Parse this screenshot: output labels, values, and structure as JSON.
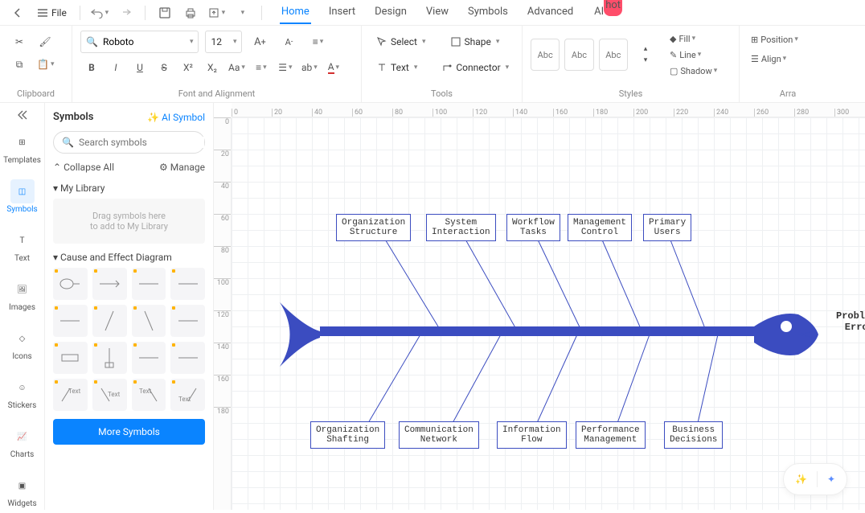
{
  "menubar": {
    "file": "File"
  },
  "tabs": [
    "Home",
    "Insert",
    "Design",
    "View",
    "Symbols",
    "Advanced",
    "AI"
  ],
  "hot": "hot",
  "ribbon": {
    "font_name": "Roboto",
    "font_size": "12",
    "select": "Select",
    "shape": "Shape",
    "text": "Text",
    "connector": "Connector",
    "abc": "Abc",
    "fill": "Fill",
    "line": "Line",
    "shadow": "Shadow",
    "position": "Position",
    "align": "Align",
    "groups": {
      "clipboard": "Clipboard",
      "font": "Font and Alignment",
      "tools": "Tools",
      "styles": "Styles",
      "arrange": "Arra"
    }
  },
  "rail": {
    "templates": "Templates",
    "symbols": "Symbols",
    "text": "Text",
    "images": "Images",
    "icons": "Icons",
    "stickers": "Stickers",
    "charts": "Charts",
    "widgets": "Widgets"
  },
  "sidebar": {
    "title": "Symbols",
    "ai": "AI Symbol",
    "search_ph": "Search symbols",
    "collapse": "Collapse All",
    "manage": "Manage",
    "mylib": "My Library",
    "drop1": "Drag symbols here",
    "drop2": "to add to My Library",
    "cat": "Cause and Effect Diagram",
    "more": "More Symbols"
  },
  "ruler_h": [
    "0",
    "20",
    "40",
    "60",
    "80",
    "100",
    "120",
    "140",
    "160",
    "180",
    "200",
    "220",
    "240",
    "260",
    "280",
    "300"
  ],
  "ruler_v": [
    "0",
    "20",
    "40",
    "60",
    "80",
    "100",
    "120",
    "140",
    "160",
    "180"
  ],
  "diagram": {
    "problem": "Problem/\nError",
    "top": [
      "Organization\nStructure",
      "System\nInteraction",
      "Workflow\nTasks",
      "Management\nControl",
      "Primary\nUsers"
    ],
    "bottom": [
      "Organization\nShafting",
      "Communication\nNetwork",
      "Information\nFlow",
      "Performance\nManagement",
      "Business\nDecisions"
    ]
  }
}
